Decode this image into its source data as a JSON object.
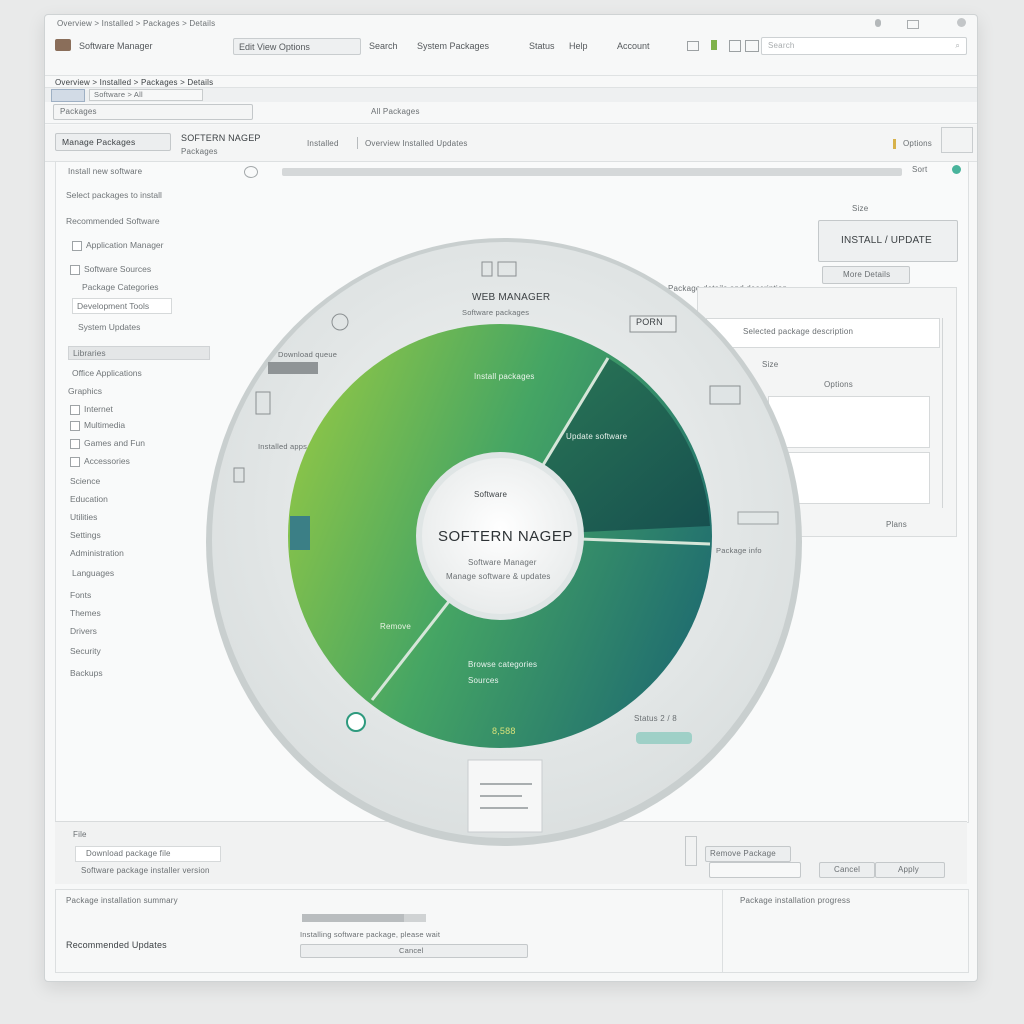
{
  "window": {
    "title": "SOFTERN NAGEP",
    "menu": [
      "Software Manager",
      "Edit View Options",
      "Search",
      "System Packages",
      "Status",
      "Help",
      "Account"
    ],
    "breadcrumb": "Overview > Installed > Packages > Details",
    "search_placeholder": "Search"
  },
  "toolbar": {
    "tab_label": "Packages",
    "path_label": "Software > All",
    "sub_label": "All Packages"
  },
  "panel": {
    "title_button": "Manage Packages",
    "title": "SOFTERN NAGEP",
    "subtitle": "Packages",
    "view_label": "Installed",
    "filter_label": "Overview Installed Updates",
    "right_label": "Options",
    "status_left": "Install new software",
    "status_right": "Sort"
  },
  "sidebar": {
    "header": "Select packages to install",
    "items": [
      "Recommended Software",
      "Application Manager",
      "Software Sources",
      "Package Categories",
      "Development Tools",
      "System Updates",
      "Libraries",
      "Office Applications",
      "Graphics",
      "Internet",
      "Multimedia",
      "Games and Fun",
      "Accessories",
      "Science",
      "Education",
      "Utilities",
      "Settings",
      "Administration",
      "Languages",
      "Fonts",
      "Themes",
      "Drivers",
      "Security",
      "Backups"
    ]
  },
  "disc": {
    "ring_title": "WEB MANAGER",
    "ring_subtitle": "Software packages",
    "center_top": "Software",
    "center_title": "SOFTERN NAGEP",
    "center_line1": "Software Manager",
    "center_line2": "Manage software & updates",
    "segment_labels": [
      "Install packages",
      "Update software",
      "Remove",
      "Browse categories",
      "Sources"
    ],
    "bottom_value": "8,588",
    "edge_labels": [
      "Download queue",
      "Installed apps",
      "Package info",
      "Status 2 / 8"
    ]
  },
  "right": {
    "button": "INSTALL / UPDATE",
    "sub_button": "More Details",
    "header": "Package details and description",
    "pill": "PORN",
    "field": "Selected package description",
    "tag": "Size",
    "badge": "Options",
    "footer": "Plans"
  },
  "bottom": {
    "label": "File",
    "field": "Download package file",
    "field2": "Software package installer version",
    "right_field": "Remove Package",
    "right_btn1": "Cancel",
    "right_btn2": "Apply"
  },
  "footer": {
    "header": "Package installation summary",
    "right_header": "Package installation progress",
    "left_label": "Recommended Updates",
    "progress_caption": "Installing software package, please wait",
    "progress_fraction": 0.82,
    "progress_button": "Cancel"
  },
  "colors": {
    "green_light": "#7cc04a",
    "green_mid": "#3c9a5a",
    "teal_dark": "#1f6f6a",
    "disc_ring": "#e4e8e8"
  }
}
